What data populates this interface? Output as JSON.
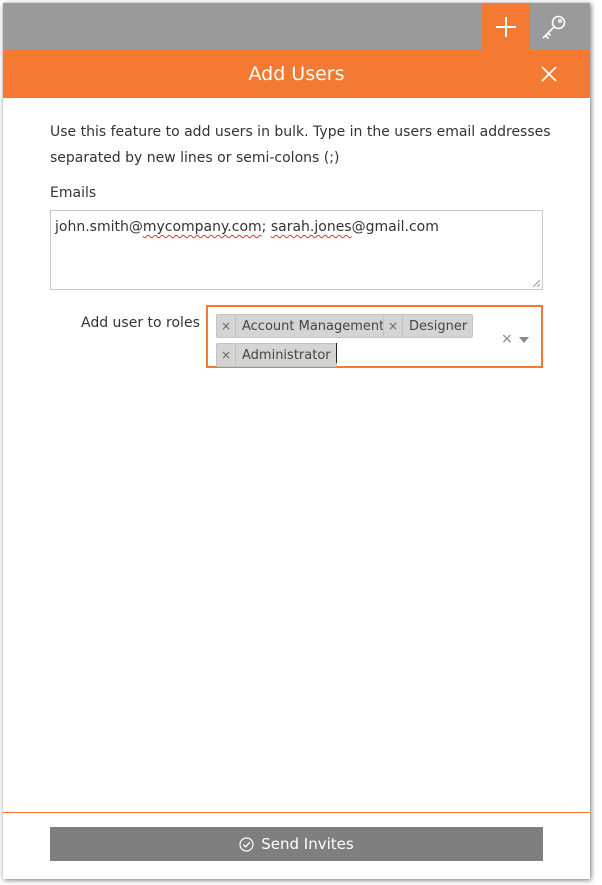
{
  "colors": {
    "accent": "#f47932",
    "topbar": "#9a9a9a",
    "button": "#7f7f7f"
  },
  "toolbar": {
    "add_icon": "plus-icon",
    "key_icon": "key-icon"
  },
  "dialog": {
    "title": "Add Users",
    "close_icon": "close-icon",
    "intro_line1": "Use this feature to add users in bulk. Type in the users email addresses",
    "intro_line2": "separated by new lines or semi-colons (;)"
  },
  "emails": {
    "label": "Emails",
    "value_part1": "john.smith@",
    "value_part2": "mycompany.com",
    "value_part3": "; ",
    "value_part4": "sarah.jones",
    "value_part5": "@gmail.com"
  },
  "roles": {
    "label": "Add user to roles",
    "tags": [
      {
        "remove": "×",
        "label": "Account Management"
      },
      {
        "remove": "×",
        "label": "Designer"
      },
      {
        "remove": "×",
        "label": "Administrator"
      }
    ],
    "clear": "×"
  },
  "footer": {
    "send_label": "Send Invites",
    "send_icon": "check-circle-icon"
  }
}
